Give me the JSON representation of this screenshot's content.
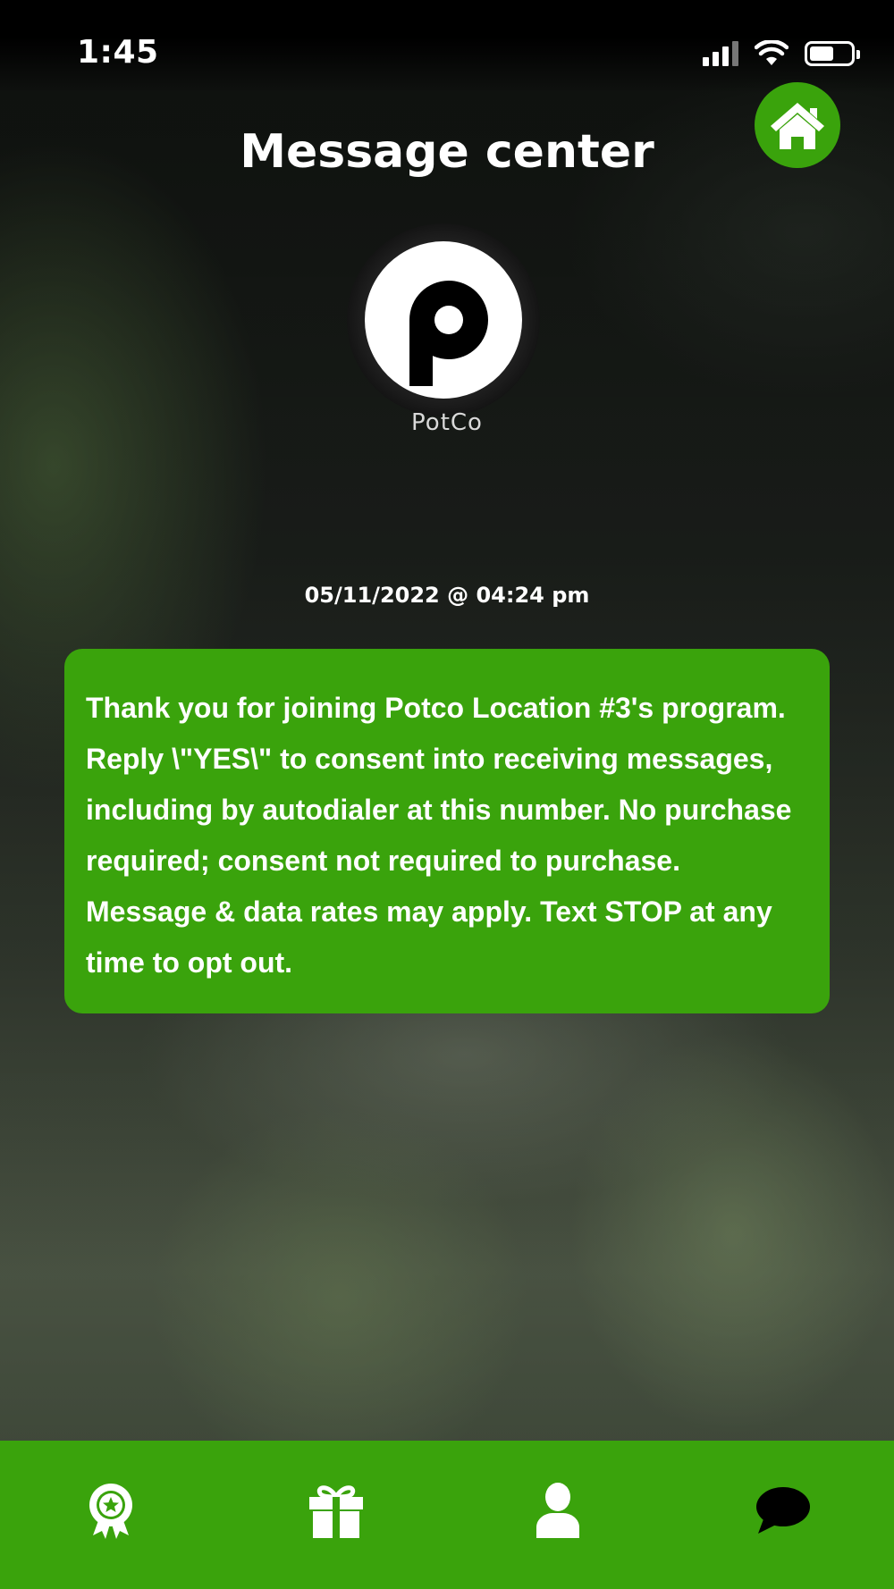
{
  "status_bar": {
    "time": "1:45",
    "signal_icon": "cellular-signal-icon",
    "wifi_icon": "wifi-icon",
    "battery_icon": "battery-icon"
  },
  "header": {
    "title": "Message center",
    "home_icon": "home-icon"
  },
  "logo": {
    "name": "PotCo"
  },
  "message": {
    "timestamp": "05/11/2022 @ 04:24 pm",
    "text": "Thank you for joining Potco Location #3's program. Reply \\\"YES\\\" to consent into receiving messages, including by autodialer at this number. No purchase required; consent not required to purchase. Message & data rates may apply. Text STOP at any time to opt out."
  },
  "bottom_nav": {
    "items": [
      {
        "icon": "award-badge-icon"
      },
      {
        "icon": "gift-icon"
      },
      {
        "icon": "user-profile-icon"
      },
      {
        "icon": "chat-bubble-icon"
      }
    ]
  },
  "colors": {
    "accent_green": "#3aa30c",
    "text": "#ffffff",
    "nav_icon_active": "#000000"
  }
}
